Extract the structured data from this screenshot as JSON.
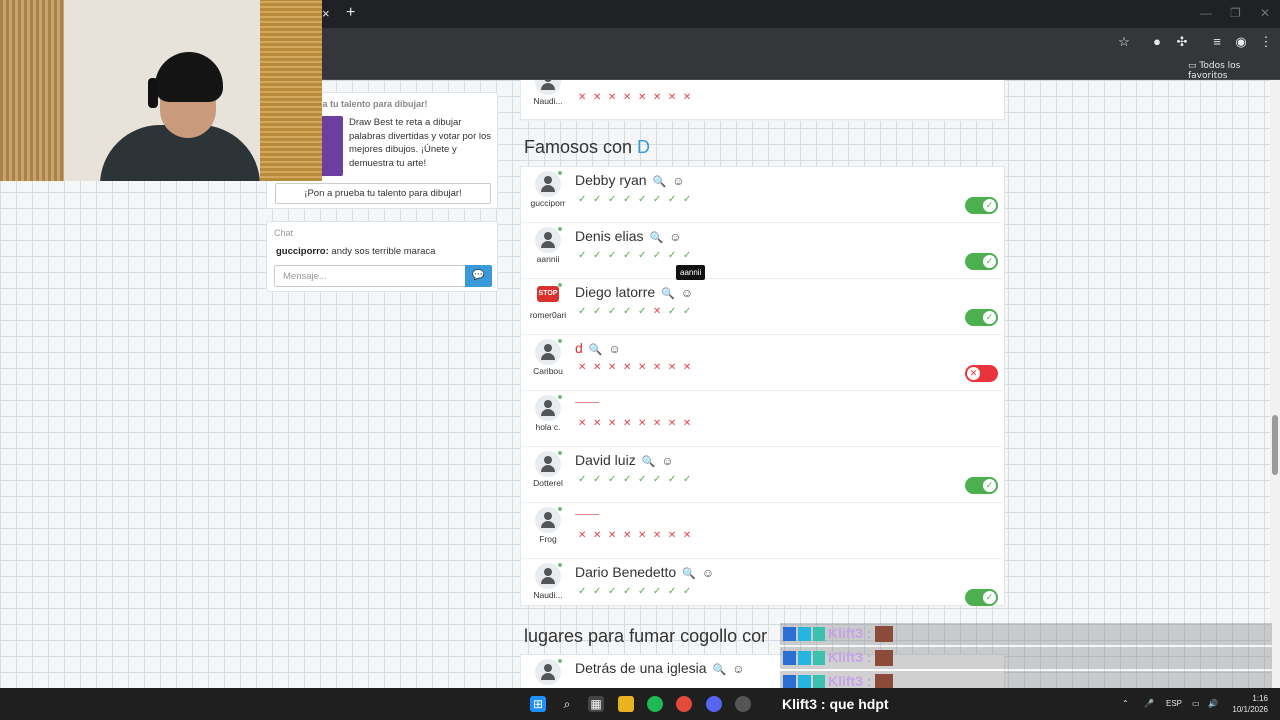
{
  "browser": {
    "tab_close": "×",
    "new_tab": "+",
    "bookmarks_folder": "Todos los favoritos"
  },
  "sidebar": {
    "promo": {
      "title": "ba tu talento para dibujar!",
      "text": "Draw Best te reta a dibujar palabras divertidas y votar por los mejores dibujos. ¡Únete y demuestra tu arte!",
      "button": "¡Pon a prueba tu talento para dibujar!"
    },
    "chat": {
      "title": "Chat",
      "message_user": "gucciporro:",
      "message_text": " andy sos terrible maraca",
      "input_placeholder": "Mensaje..."
    }
  },
  "main": {
    "top_row": {
      "username": "Naudi...",
      "votes": "✕✕✕✕✕✕✕✕"
    },
    "section_d": {
      "title_prefix": "Famosos con ",
      "title_letter": "D"
    },
    "rows": [
      {
        "answer": "Debby ryan",
        "username": "gucciporr",
        "votes": "✓✓✓✓✓✓✓✓",
        "status": "ok"
      },
      {
        "answer": "Denis elias",
        "username": "aannii",
        "votes": "✓✓✓✓✓✓✓✓",
        "status": "ok"
      },
      {
        "answer": "Diego latorre",
        "username": "romer0ari",
        "votes": "✓✓✓✓✓✕✓✓",
        "status": "ok"
      },
      {
        "answer": "d",
        "username": "Caribou",
        "votes": "✕✕✕✕✕✕✕✕",
        "status": "bad"
      },
      {
        "answer": "",
        "username": "hola c.",
        "votes": "✕✕✕✕✕✕✕✕",
        "status": "none"
      },
      {
        "answer": "David luiz",
        "username": "Dotterel",
        "votes": "✓✓✓✓✓✓✓✓",
        "status": "ok"
      },
      {
        "answer": "",
        "username": "Frog",
        "votes": "✕✕✕✕✕✕✕✕",
        "status": "none"
      },
      {
        "answer": "Dario Benedetto",
        "username": "Naudi...",
        "votes": "✓✓✓✓✓✓✓✓",
        "status": "ok"
      }
    ],
    "tooltip": "aannii",
    "section_next": {
      "title": "lugares para fumar cogollo cor"
    },
    "next_row": {
      "answer": "Detrás de una iglesia"
    }
  },
  "stream_overlay": {
    "lines": [
      {
        "user": "Klift3 :"
      },
      {
        "user": "Klift3 :"
      },
      {
        "user": "Klift3 :"
      }
    ],
    "latest": "Klift3 : que hdpt"
  },
  "taskbar": {
    "lang": "ESP",
    "time": "1:16",
    "date": "10/1/2026"
  },
  "colors": {
    "accent": "#3a9ad9",
    "ok": "#4caf50",
    "bad": "#e04848"
  }
}
